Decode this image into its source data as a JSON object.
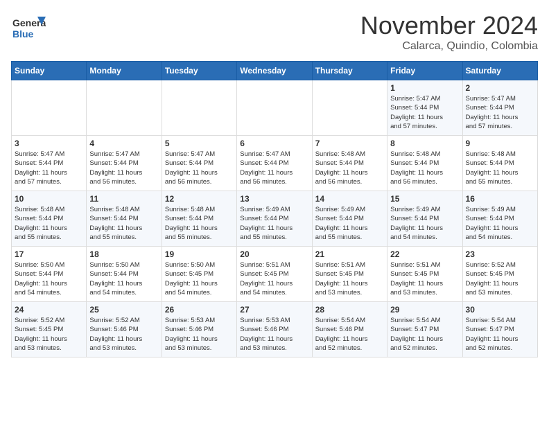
{
  "header": {
    "logo_line1": "General",
    "logo_line2": "Blue",
    "month": "November 2024",
    "location": "Calarca, Quindio, Colombia"
  },
  "days_of_week": [
    "Sunday",
    "Monday",
    "Tuesday",
    "Wednesday",
    "Thursday",
    "Friday",
    "Saturday"
  ],
  "weeks": [
    [
      {
        "day": "",
        "info": ""
      },
      {
        "day": "",
        "info": ""
      },
      {
        "day": "",
        "info": ""
      },
      {
        "day": "",
        "info": ""
      },
      {
        "day": "",
        "info": ""
      },
      {
        "day": "1",
        "info": "Sunrise: 5:47 AM\nSunset: 5:44 PM\nDaylight: 11 hours\nand 57 minutes."
      },
      {
        "day": "2",
        "info": "Sunrise: 5:47 AM\nSunset: 5:44 PM\nDaylight: 11 hours\nand 57 minutes."
      }
    ],
    [
      {
        "day": "3",
        "info": "Sunrise: 5:47 AM\nSunset: 5:44 PM\nDaylight: 11 hours\nand 57 minutes."
      },
      {
        "day": "4",
        "info": "Sunrise: 5:47 AM\nSunset: 5:44 PM\nDaylight: 11 hours\nand 56 minutes."
      },
      {
        "day": "5",
        "info": "Sunrise: 5:47 AM\nSunset: 5:44 PM\nDaylight: 11 hours\nand 56 minutes."
      },
      {
        "day": "6",
        "info": "Sunrise: 5:47 AM\nSunset: 5:44 PM\nDaylight: 11 hours\nand 56 minutes."
      },
      {
        "day": "7",
        "info": "Sunrise: 5:48 AM\nSunset: 5:44 PM\nDaylight: 11 hours\nand 56 minutes."
      },
      {
        "day": "8",
        "info": "Sunrise: 5:48 AM\nSunset: 5:44 PM\nDaylight: 11 hours\nand 56 minutes."
      },
      {
        "day": "9",
        "info": "Sunrise: 5:48 AM\nSunset: 5:44 PM\nDaylight: 11 hours\nand 55 minutes."
      }
    ],
    [
      {
        "day": "10",
        "info": "Sunrise: 5:48 AM\nSunset: 5:44 PM\nDaylight: 11 hours\nand 55 minutes."
      },
      {
        "day": "11",
        "info": "Sunrise: 5:48 AM\nSunset: 5:44 PM\nDaylight: 11 hours\nand 55 minutes."
      },
      {
        "day": "12",
        "info": "Sunrise: 5:48 AM\nSunset: 5:44 PM\nDaylight: 11 hours\nand 55 minutes."
      },
      {
        "day": "13",
        "info": "Sunrise: 5:49 AM\nSunset: 5:44 PM\nDaylight: 11 hours\nand 55 minutes."
      },
      {
        "day": "14",
        "info": "Sunrise: 5:49 AM\nSunset: 5:44 PM\nDaylight: 11 hours\nand 55 minutes."
      },
      {
        "day": "15",
        "info": "Sunrise: 5:49 AM\nSunset: 5:44 PM\nDaylight: 11 hours\nand 54 minutes."
      },
      {
        "day": "16",
        "info": "Sunrise: 5:49 AM\nSunset: 5:44 PM\nDaylight: 11 hours\nand 54 minutes."
      }
    ],
    [
      {
        "day": "17",
        "info": "Sunrise: 5:50 AM\nSunset: 5:44 PM\nDaylight: 11 hours\nand 54 minutes."
      },
      {
        "day": "18",
        "info": "Sunrise: 5:50 AM\nSunset: 5:44 PM\nDaylight: 11 hours\nand 54 minutes."
      },
      {
        "day": "19",
        "info": "Sunrise: 5:50 AM\nSunset: 5:45 PM\nDaylight: 11 hours\nand 54 minutes."
      },
      {
        "day": "20",
        "info": "Sunrise: 5:51 AM\nSunset: 5:45 PM\nDaylight: 11 hours\nand 54 minutes."
      },
      {
        "day": "21",
        "info": "Sunrise: 5:51 AM\nSunset: 5:45 PM\nDaylight: 11 hours\nand 53 minutes."
      },
      {
        "day": "22",
        "info": "Sunrise: 5:51 AM\nSunset: 5:45 PM\nDaylight: 11 hours\nand 53 minutes."
      },
      {
        "day": "23",
        "info": "Sunrise: 5:52 AM\nSunset: 5:45 PM\nDaylight: 11 hours\nand 53 minutes."
      }
    ],
    [
      {
        "day": "24",
        "info": "Sunrise: 5:52 AM\nSunset: 5:45 PM\nDaylight: 11 hours\nand 53 minutes."
      },
      {
        "day": "25",
        "info": "Sunrise: 5:52 AM\nSunset: 5:46 PM\nDaylight: 11 hours\nand 53 minutes."
      },
      {
        "day": "26",
        "info": "Sunrise: 5:53 AM\nSunset: 5:46 PM\nDaylight: 11 hours\nand 53 minutes."
      },
      {
        "day": "27",
        "info": "Sunrise: 5:53 AM\nSunset: 5:46 PM\nDaylight: 11 hours\nand 53 minutes."
      },
      {
        "day": "28",
        "info": "Sunrise: 5:54 AM\nSunset: 5:46 PM\nDaylight: 11 hours\nand 52 minutes."
      },
      {
        "day": "29",
        "info": "Sunrise: 5:54 AM\nSunset: 5:47 PM\nDaylight: 11 hours\nand 52 minutes."
      },
      {
        "day": "30",
        "info": "Sunrise: 5:54 AM\nSunset: 5:47 PM\nDaylight: 11 hours\nand 52 minutes."
      }
    ]
  ]
}
